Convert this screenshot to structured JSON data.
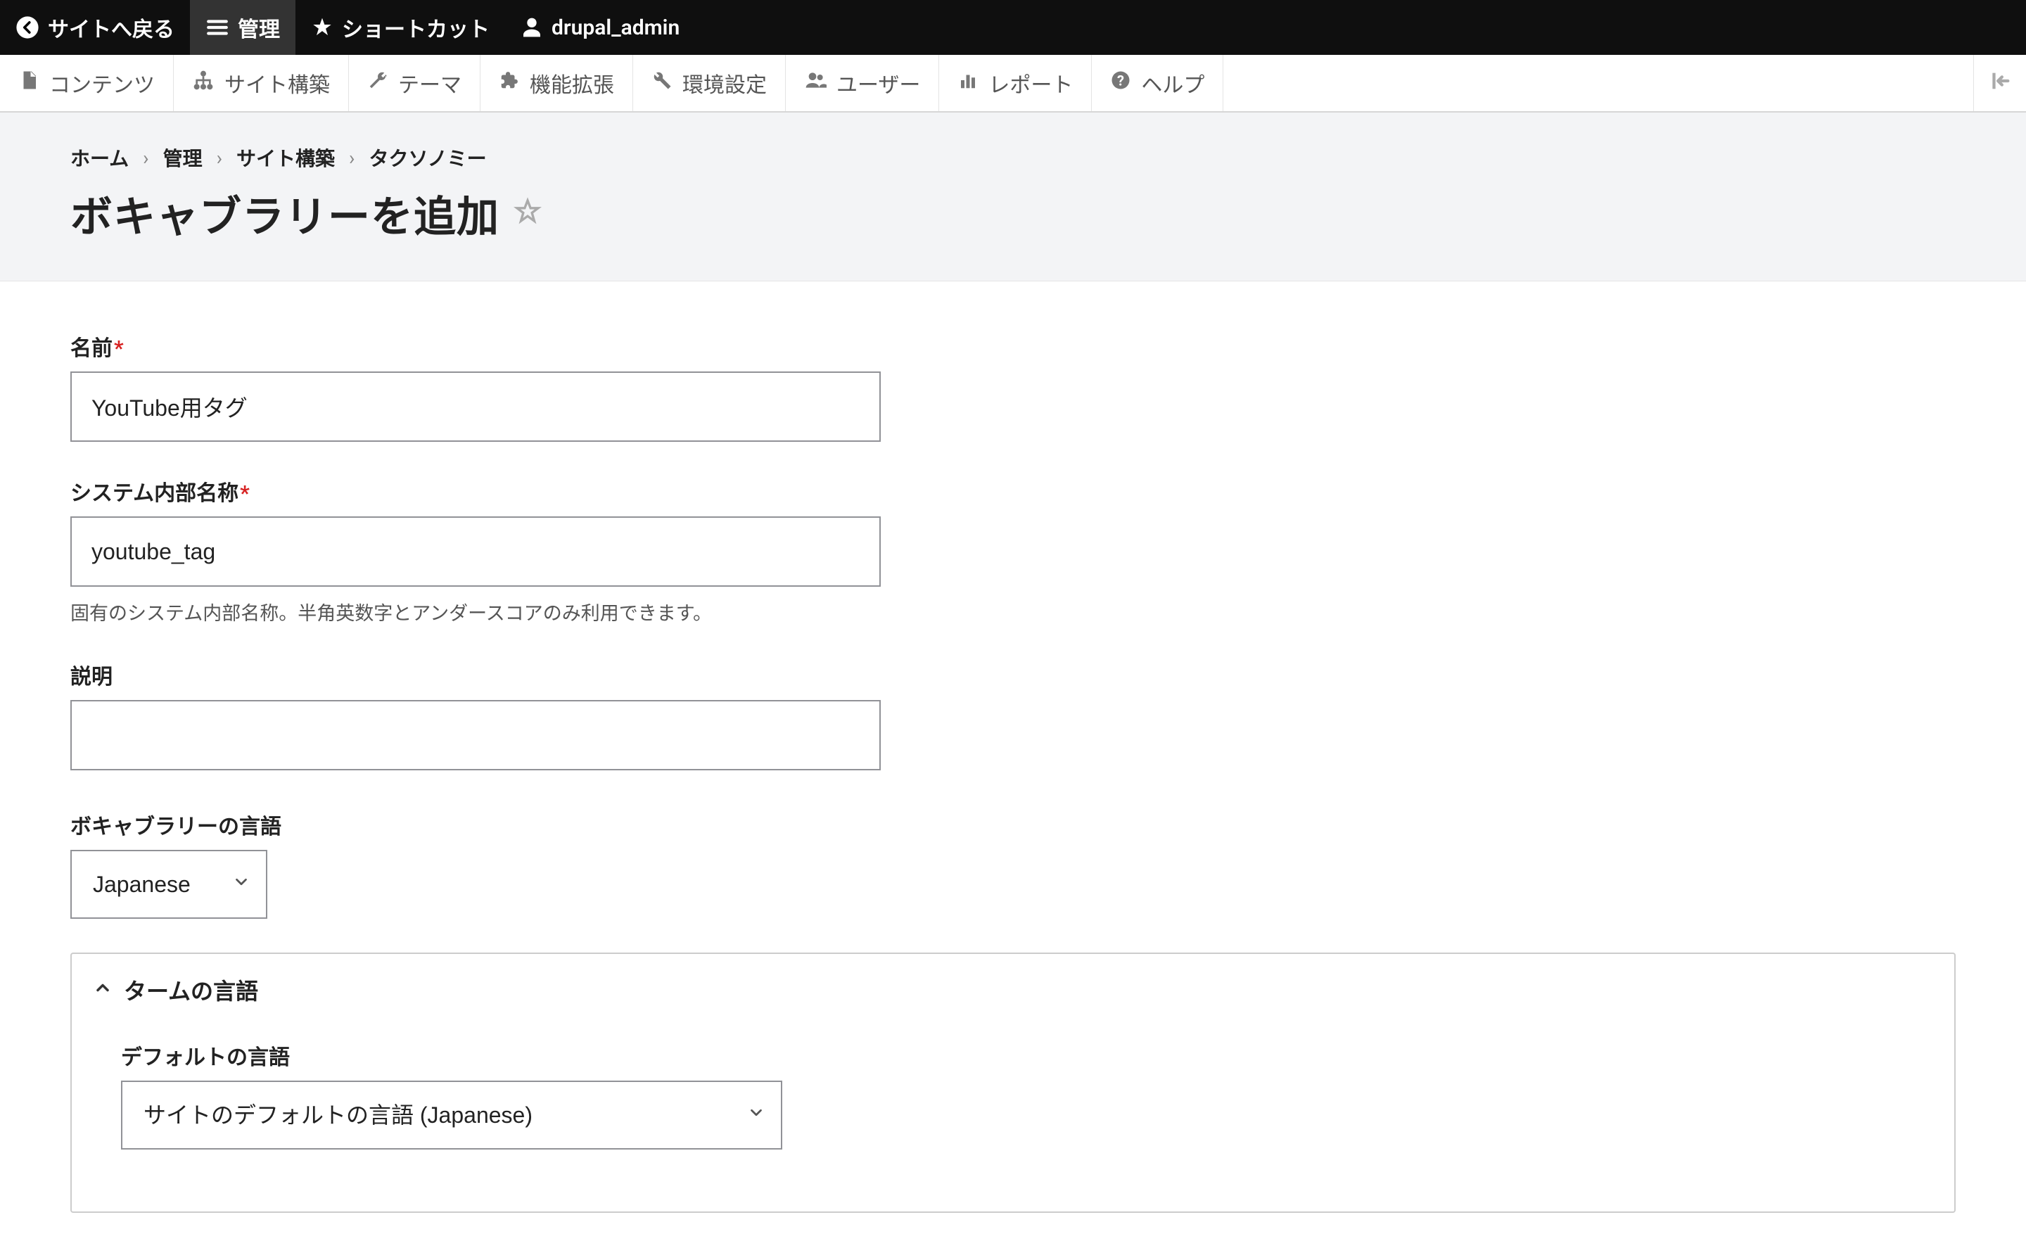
{
  "toolbar": {
    "back": "サイトへ戻る",
    "manage": "管理",
    "shortcuts": "ショートカット",
    "user": "drupal_admin"
  },
  "admin_menu": {
    "content": "コンテンツ",
    "structure": "サイト構築",
    "appearance": "テーマ",
    "extend": "機能拡張",
    "config": "環境設定",
    "people": "ユーザー",
    "reports": "レポート",
    "help": "ヘルプ"
  },
  "breadcrumb": {
    "home": "ホーム",
    "admin": "管理",
    "structure": "サイト構築",
    "taxonomy": "タクソノミー",
    "sep": "›"
  },
  "page_title": "ボキャブラリーを追加",
  "form": {
    "name_label": "名前",
    "name_value": "YouTube用タグ",
    "machine_label": "システム内部名称",
    "machine_value": "youtube_tag",
    "machine_help": "固有のシステム内部名称。半角英数字とアンダースコアのみ利用できます。",
    "desc_label": "説明",
    "desc_value": "",
    "lang_label": "ボキャブラリーの言語",
    "lang_value": "Japanese"
  },
  "details": {
    "summary": "タームの言語",
    "default_lang_label": "デフォルトの言語",
    "default_lang_value": "サイトのデフォルトの言語 (Japanese)"
  }
}
